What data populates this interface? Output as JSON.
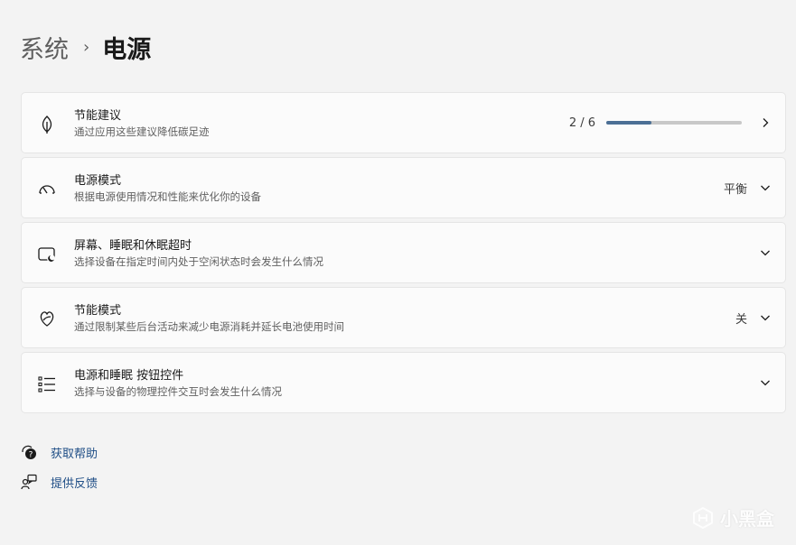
{
  "breadcrumb": {
    "parent": "系统",
    "separator": "›",
    "current": "电源"
  },
  "cards": [
    {
      "icon": "leaf-icon",
      "title": "节能建议",
      "subtitle": "通过应用这些建议降低碳足迹",
      "progress_text": "2 / 6",
      "progress_fraction": 0.33
    },
    {
      "icon": "speedometer-icon",
      "title": "电源模式",
      "subtitle": "根据电源使用情况和性能来优化你的设备",
      "value": "平衡"
    },
    {
      "icon": "screen-sleep-icon",
      "title": "屏幕、睡眠和休眠超时",
      "subtitle": "选择设备在指定时间内处于空闲状态时会发生什么情况"
    },
    {
      "icon": "energy-saver-icon",
      "title": "节能模式",
      "subtitle": "通过限制某些后台活动来减少电源消耗并延长电池使用时间",
      "value": "关"
    },
    {
      "icon": "list-icon",
      "title": "电源和睡眠 按钮控件",
      "subtitle": "选择与设备的物理控件交互时会发生什么情况"
    }
  ],
  "links": [
    {
      "icon": "help-icon",
      "label": "获取帮助"
    },
    {
      "icon": "feedback-icon",
      "label": "提供反馈"
    }
  ],
  "watermark": {
    "text": "小黑盒"
  },
  "colors": {
    "accent": "#4b6f95",
    "link": "#1f4e86",
    "background": "#f3f3f3",
    "card": "#fbfbfb"
  }
}
